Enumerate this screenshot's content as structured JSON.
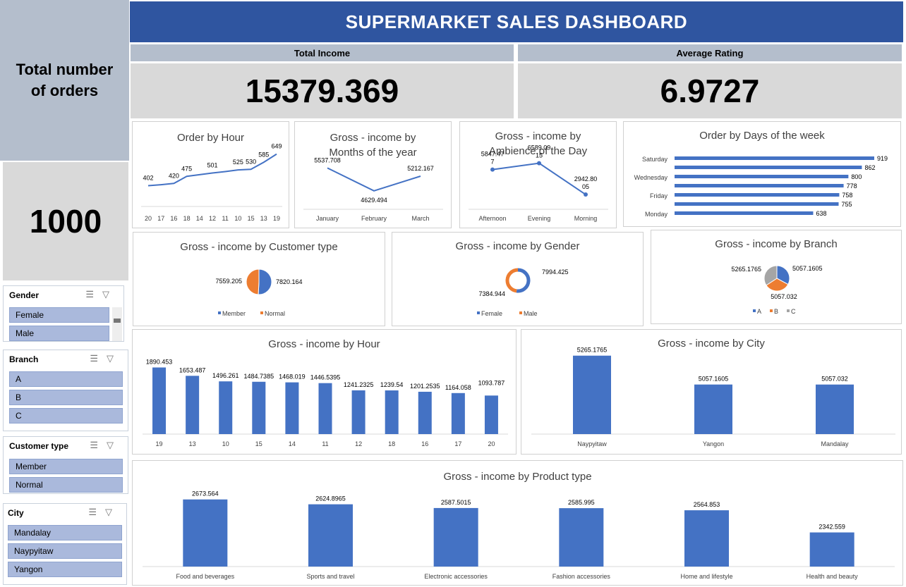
{
  "dashboard_title": "SUPERMARKET SALES DASHBOARD",
  "kpis": {
    "total_income_label": "Total Income",
    "total_income_value": "15379.369",
    "avg_rating_label": "Average Rating",
    "avg_rating_value": "6.9727",
    "orders_label": "Total number of orders",
    "orders_value": "1000"
  },
  "slicers": {
    "gender": {
      "title": "Gender",
      "items": [
        "Female",
        "Male"
      ]
    },
    "branch": {
      "title": "Branch",
      "items": [
        "A",
        "B",
        "C"
      ]
    },
    "customer_type": {
      "title": "Customer type",
      "items": [
        "Member",
        "Normal"
      ]
    },
    "city": {
      "title": "City",
      "items": [
        "Mandalay",
        "Naypyitaw",
        "Yangon"
      ]
    }
  },
  "colors": {
    "blue": "#4472c4",
    "orange": "#ed7d31",
    "gray": "#a5a5a5",
    "banner": "#2f55a0"
  },
  "chart_data": [
    {
      "id": "order_by_hour",
      "type": "line",
      "title": "Order by Hour",
      "categories": [
        "20",
        "17",
        "16",
        "18",
        "14",
        "12",
        "11",
        "10",
        "15",
        "13",
        "19"
      ],
      "values": [
        null,
        402,
        420,
        475,
        501,
        null,
        null,
        525,
        530,
        585,
        649
      ],
      "points": [
        402,
        410,
        420,
        475,
        488,
        501,
        512,
        525,
        530,
        585,
        649
      ],
      "data_labels": [
        "402",
        "",
        "420",
        "475",
        "",
        "501",
        "",
        "525",
        "530",
        "585",
        "649"
      ]
    },
    {
      "id": "income_by_month",
      "type": "line",
      "title": "Gross - income by Months of the year",
      "categories": [
        "January",
        "February",
        "March"
      ],
      "values": [
        5537.708,
        4629.494,
        5212.167
      ],
      "data_labels": [
        "5537.708",
        "4629.494",
        "5212.167"
      ]
    },
    {
      "id": "income_by_ambience",
      "type": "line",
      "title": "Gross - income by Ambience of the Day",
      "categories": [
        "Afternoon",
        "Evening",
        "Morning"
      ],
      "values": [
        5847.477,
        6589.0915,
        2942.8005
      ],
      "data_labels": [
        "5847.47\n7",
        "6589.09\n15",
        "2942.80\n05"
      ]
    },
    {
      "id": "orders_by_weekday",
      "type": "bar",
      "orientation": "horizontal",
      "title": "Order by Days of the week",
      "categories": [
        "Saturday",
        "",
        "Wednesday",
        "",
        "Friday",
        "",
        "Monday"
      ],
      "values": [
        919,
        862,
        800,
        778,
        758,
        755,
        638
      ]
    },
    {
      "id": "income_by_customer_type",
      "type": "pie",
      "title": "Gross - income by  Customer type",
      "categories": [
        "Member",
        "Normal"
      ],
      "values": [
        7820.164,
        7559.205
      ],
      "legend": [
        "Member",
        "Normal"
      ]
    },
    {
      "id": "income_by_gender",
      "type": "pie",
      "style": "doughnut",
      "title": "Gross - income by  Gender",
      "categories": [
        "Female",
        "Male"
      ],
      "values": [
        7994.425,
        7384.944
      ],
      "legend": [
        "Female",
        "Male"
      ]
    },
    {
      "id": "income_by_branch",
      "type": "pie",
      "title": "Gross - income by  Branch",
      "categories": [
        "A",
        "B",
        "C"
      ],
      "values": [
        5057.1605,
        5057.032,
        5265.1765
      ],
      "legend": [
        "A",
        "B",
        "C"
      ]
    },
    {
      "id": "income_by_hour",
      "type": "bar",
      "title": "Gross - income by  Hour",
      "categories": [
        "19",
        "13",
        "10",
        "15",
        "14",
        "11",
        "12",
        "18",
        "16",
        "17",
        "20"
      ],
      "values": [
        1890.453,
        1653.487,
        1496.261,
        1484.7385,
        1468.019,
        1446.5395,
        1241.2325,
        1239.54,
        1201.2535,
        1164.058,
        1093.787
      ],
      "ylim": [
        0,
        2000
      ]
    },
    {
      "id": "income_by_city",
      "type": "bar",
      "title": "Gross - income by  City",
      "categories": [
        "Naypyitaw",
        "Yangon",
        "Mandalay"
      ],
      "values": [
        5265.1765,
        5057.1605,
        5057.032
      ],
      "ylim": [
        4700,
        5350
      ]
    },
    {
      "id": "income_by_product",
      "type": "bar",
      "title": "Gross - income by  Product type",
      "categories": [
        "Food and beverages",
        "Sports and travel",
        "Electronic accessories",
        "Fashion accessories",
        "Home and lifestyle",
        "Health and beauty"
      ],
      "values": [
        2673.564,
        2624.8965,
        2587.5015,
        2585.995,
        2564.853,
        2342.559
      ],
      "ylim": [
        2000,
        2700
      ]
    }
  ]
}
